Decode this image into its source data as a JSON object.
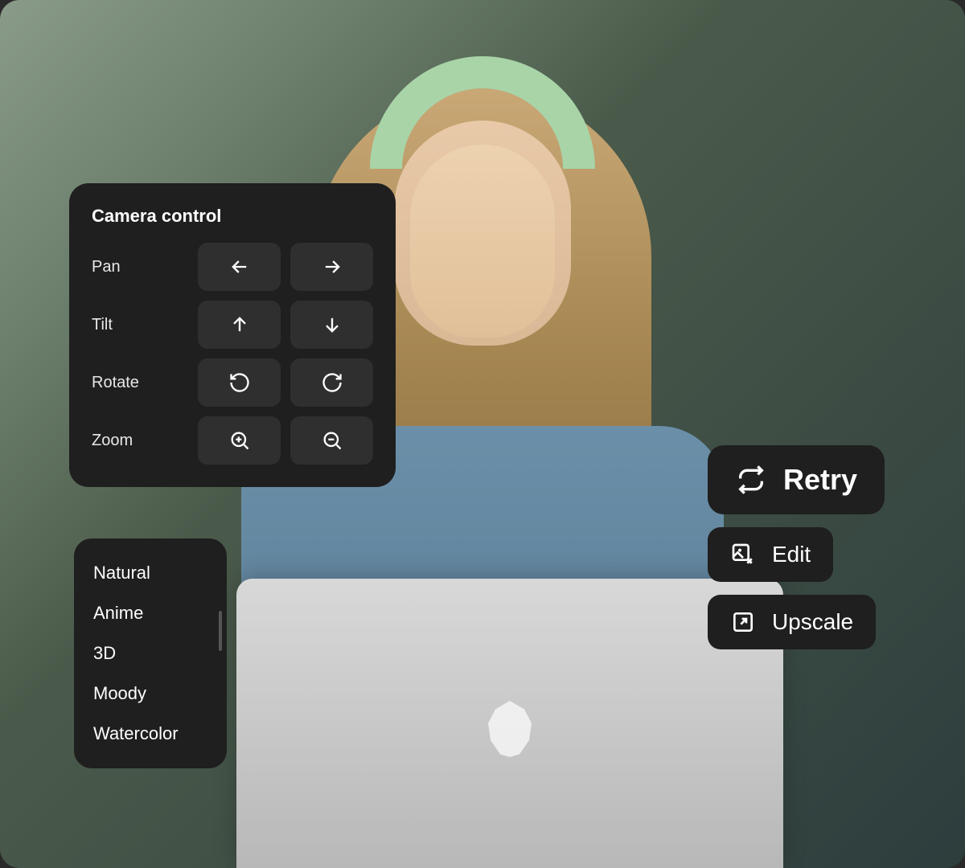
{
  "camera": {
    "title": "Camera control",
    "rows": [
      {
        "label": "Pan"
      },
      {
        "label": "Tilt"
      },
      {
        "label": "Rotate"
      },
      {
        "label": "Zoom"
      }
    ]
  },
  "styles": {
    "items": [
      {
        "label": "Natural"
      },
      {
        "label": "Anime"
      },
      {
        "label": "3D"
      },
      {
        "label": "Moody"
      },
      {
        "label": "Watercolor"
      }
    ]
  },
  "actions": {
    "retry": "Retry",
    "edit": "Edit",
    "upscale": "Upscale"
  }
}
